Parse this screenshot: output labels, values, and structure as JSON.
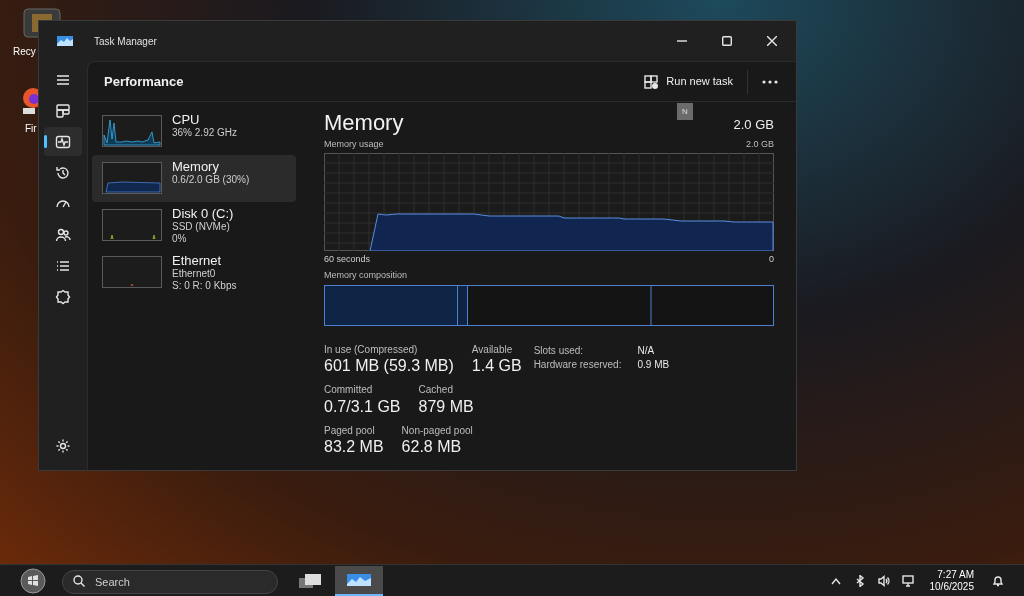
{
  "desktop_icons": [
    {
      "kind": "bin",
      "label": "Recy"
    },
    {
      "kind": "browser",
      "label": "Fir"
    }
  ],
  "window": {
    "title": "Task Manager"
  },
  "nav": [
    {
      "kind": "menu",
      "selected": false
    },
    {
      "kind": "processes",
      "selected": false
    },
    {
      "kind": "performance",
      "selected": true
    },
    {
      "kind": "history",
      "selected": false
    },
    {
      "kind": "startup",
      "selected": false
    },
    {
      "kind": "users",
      "selected": false
    },
    {
      "kind": "details",
      "selected": false
    },
    {
      "kind": "services",
      "selected": false
    },
    {
      "kind": "settings",
      "selected": false
    }
  ],
  "header": {
    "title": "Performance",
    "run_new_task": "Run new task",
    "badge": "N"
  },
  "devices": [
    {
      "kind": "cpu",
      "name": "CPU",
      "lines": [
        "36% 2.92 GHz"
      ],
      "selected": false
    },
    {
      "kind": "memory",
      "name": "Memory",
      "lines": [
        "0.6/2.0 GB (30%)"
      ],
      "selected": true
    },
    {
      "kind": "disk",
      "name": "Disk 0 (C:)",
      "lines": [
        "SSD (NVMe)",
        "0%"
      ],
      "selected": false
    },
    {
      "kind": "ethernet",
      "name": "Ethernet",
      "lines": [
        "Ethernet0",
        "S: 0 R: 0 Kbps"
      ],
      "selected": false
    }
  ],
  "detail": {
    "title": "Memory",
    "capacity": "2.0 GB",
    "usage_label": "Memory usage",
    "usage_max": "2.0 GB",
    "x_start": "60 seconds",
    "x_end": "0",
    "composition_label": "Memory composition",
    "stats": [
      [
        {
          "label": "In use (Compressed)",
          "value": "601 MB (59.3 MB)"
        },
        {
          "label": "Available",
          "value": "1.4 GB"
        }
      ],
      [
        {
          "label": "Committed",
          "value": "0.7/3.1 GB"
        },
        {
          "label": "Cached",
          "value": "879 MB"
        }
      ],
      [
        {
          "label": "Paged pool",
          "value": "83.2 MB"
        },
        {
          "label": "Non-paged pool",
          "value": "62.8 MB"
        }
      ]
    ],
    "side_stats": [
      {
        "label": "Slots used:",
        "value": "N/A"
      },
      {
        "label": "Hardware reserved:",
        "value": "0.9 MB"
      }
    ]
  },
  "taskbar": {
    "search_placeholder": "Search",
    "time": "7:27 AM",
    "date": "10/6/2025"
  }
}
